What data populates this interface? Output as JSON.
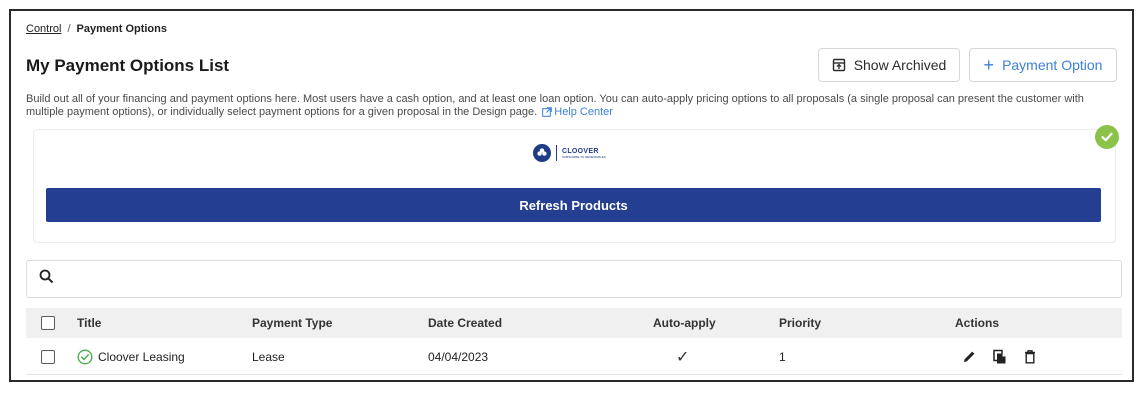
{
  "breadcrumb": {
    "parent": "Control",
    "separator": "/",
    "current": "Payment Options"
  },
  "page": {
    "title": "My Payment Options List"
  },
  "buttons": {
    "show_archived": "Show Archived",
    "add_payment_option": "Payment Option",
    "add_icon": "+"
  },
  "description": {
    "text": "Build out all of your financing and payment options here. Most users have a cash option, and at least one loan option. You can auto-apply pricing options to all proposals (a single proposal can present the customer with multiple payment options), or individually select payment options for a given proposal in the Design page.",
    "help_link": "Help Center"
  },
  "integration": {
    "logo_name": "CLOOVER",
    "logo_tagline": "SUBSCRIBE TO RENEWABLES",
    "refresh_label": "Refresh Products",
    "status_color": "#8bc34a"
  },
  "search": {
    "placeholder": "",
    "icon": "search-icon"
  },
  "table": {
    "columns": {
      "title": "Title",
      "payment_type": "Payment Type",
      "date_created": "Date Created",
      "auto_apply": "Auto-apply",
      "priority": "Priority",
      "actions": "Actions"
    },
    "rows": [
      {
        "title": "Cloover Leasing",
        "payment_type": "Lease",
        "date_created": "04/04/2023",
        "auto_apply": "✓",
        "priority": "1"
      }
    ]
  },
  "colors": {
    "accent": "#3d7fd9",
    "brand_navy": "#243f91",
    "success": "#8bc34a",
    "success_outline": "#4caf50"
  }
}
